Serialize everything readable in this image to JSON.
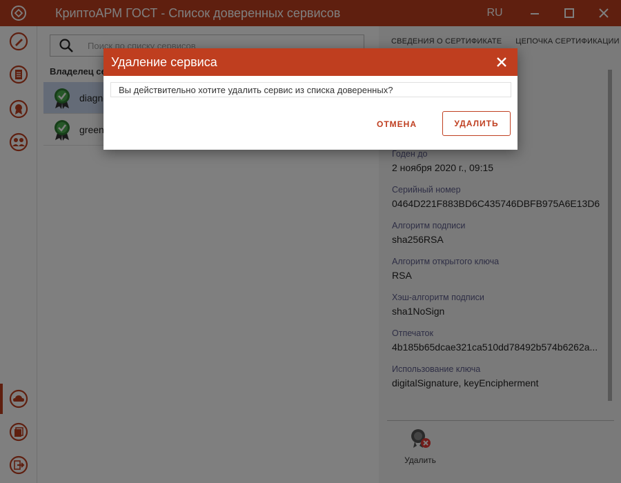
{
  "window": {
    "title": "КриптоАРМ ГОСТ - Список доверенных сервисов",
    "lang": "RU",
    "accent_color": "#bf3e1f"
  },
  "sidebar": {
    "items": [
      {
        "icon": "signature-icon"
      },
      {
        "icon": "document-icon"
      },
      {
        "icon": "certificate-icon"
      },
      {
        "icon": "contacts-icon"
      },
      {
        "icon": "cloud-icon"
      },
      {
        "icon": "log-icon"
      },
      {
        "icon": "exit-icon"
      }
    ]
  },
  "search": {
    "placeholder": "Поиск по списку сервисов",
    "value": ""
  },
  "list": {
    "header": "Владелец се",
    "items": [
      {
        "name": "diagno",
        "selected": true
      },
      {
        "name": "green.",
        "selected": false
      }
    ]
  },
  "details": {
    "tabs": [
      "СВЕДЕНИЯ О СЕРТИФИКАТЕ",
      "ЦЕПОЧКА СЕРТИФИКАЦИИ"
    ],
    "fields": [
      {
        "label": "Годен до",
        "value": "2 ноября 2020 г., 09:15"
      },
      {
        "label": "Серийный номер",
        "value": "0464D221F883BD6C435746DBFB975A6E13D6"
      },
      {
        "label": "Алгоритм подписи",
        "value": "sha256RSA"
      },
      {
        "label": "Алгоритм открытого ключа",
        "value": "RSA"
      },
      {
        "label": "Хэш-алгоритм подписи",
        "value": "sha1NoSign"
      },
      {
        "label": "Отпечаток",
        "value": "4b185b65dcae321ca510dd78492b574b6262a..."
      },
      {
        "label": "Использование ключа",
        "value": "digitalSignature, keyEncipherment"
      }
    ],
    "delete_action_label": "Удалить"
  },
  "dialog": {
    "title": "Удаление сервиса",
    "message": "Вы действительно хотите удалить сервис из списка доверенных?",
    "cancel_label": "ОТМЕНА",
    "confirm_label": "УДАЛИТЬ"
  }
}
